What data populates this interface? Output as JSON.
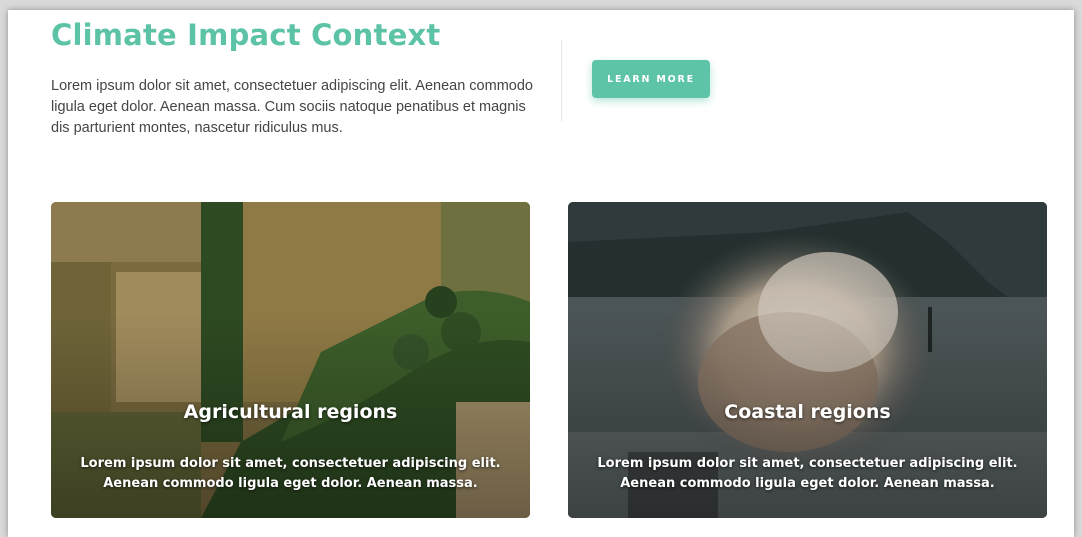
{
  "header": {
    "title": "Climate Impact Context",
    "intro": "Lorem ipsum dolor sit amet, consectetuer adipiscing elit. Aenean commodo ligula eget dolor. Aenean massa. Cum sociis natoque penatibus et magnis dis parturient montes, nascetur ridiculus mus.",
    "cta_label": "LEARN MORE"
  },
  "cards": [
    {
      "title": "Agricultural regions",
      "text": "Lorem ipsum dolor sit amet, consectetuer adipiscing elit. Aenean commodo ligula eget dolor. Aenean massa.",
      "image": "aerial-farmland-photo"
    },
    {
      "title": "Coastal regions",
      "text": "Lorem ipsum dolor sit amet, consectetuer adipiscing elit. Aenean commodo ligula eget dolor. Aenean massa.",
      "image": "crashing-wave-photo"
    }
  ],
  "colors": {
    "accent": "#5cc3a6",
    "body_text": "#454545",
    "background": "#ffffff"
  }
}
